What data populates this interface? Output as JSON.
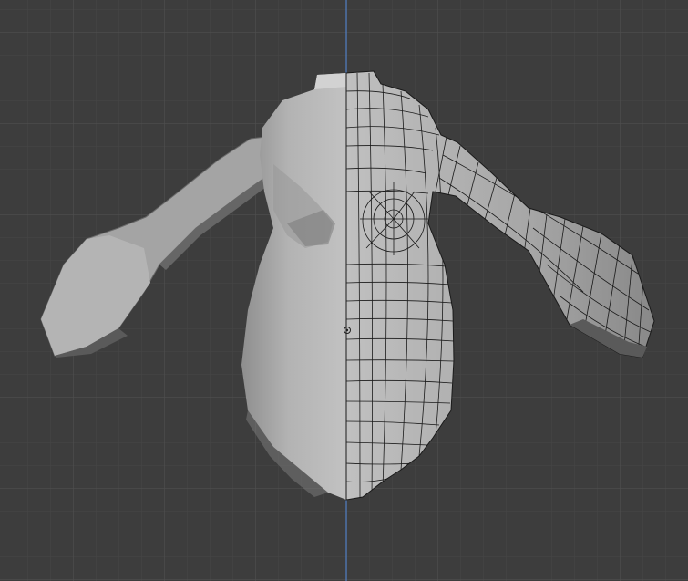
{
  "viewport": {
    "kind": "3d-viewport",
    "view": "front-orthographic",
    "background_color": "#3d3d3d",
    "grid_minor_color": "#474747",
    "grid_major_color": "#4f4f4f",
    "axis_color": "#4f7fc4"
  },
  "mesh": {
    "object": "torso-mesh",
    "shading": "solid",
    "base_color": "#a9a9a9",
    "left_half_display": "smooth-solid",
    "right_half_display": "edit-mode-wireframe",
    "wire_color": "#1a1a1a"
  },
  "icons": {
    "origin": "object-origin-icon"
  }
}
